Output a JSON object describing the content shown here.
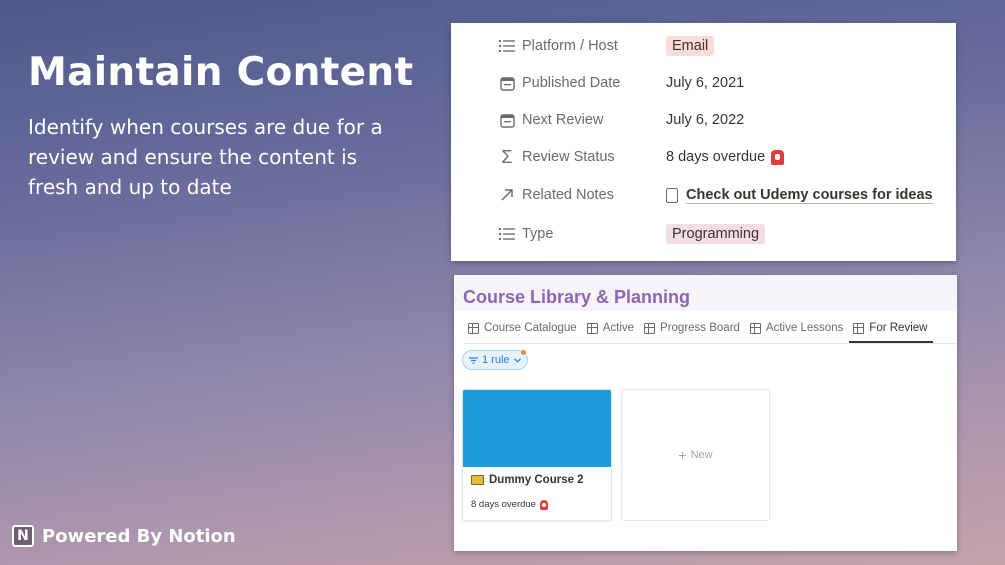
{
  "hero": {
    "title": "Maintain Content",
    "subtitle": "Identify when courses are due for a review and ensure the content is fresh and up to date"
  },
  "brand": {
    "logo_letter": "N",
    "text": "Powered By Notion"
  },
  "properties": [
    {
      "icon": "list-icon",
      "label": "Platform / Host",
      "value": "Email",
      "kind": "tag",
      "tag_color": "#fbdcd7"
    },
    {
      "icon": "calendar-icon",
      "label": "Published Date",
      "value": "July 6, 2021",
      "kind": "text"
    },
    {
      "icon": "calendar-icon",
      "label": "Next Review",
      "value": "July 6, 2022",
      "kind": "text"
    },
    {
      "icon": "sigma-icon",
      "label": "Review Status",
      "value": "8 days overdue",
      "kind": "text",
      "badge": "alarm-icon"
    },
    {
      "icon": "arrow-up-right-icon",
      "label": "Related Notes",
      "value": "Check out Udemy courses for ideas",
      "kind": "link"
    },
    {
      "icon": "list-icon",
      "label": "Type",
      "value": "Programming",
      "kind": "tag",
      "tag_color": "#f4dde5"
    }
  ],
  "database": {
    "title": "Course Library & Planning",
    "tabs": [
      {
        "label": "Course Catalogue",
        "icon": "table-icon",
        "active": false
      },
      {
        "label": "Active",
        "icon": "table-icon",
        "active": false
      },
      {
        "label": "Progress Board",
        "icon": "board-icon",
        "active": false
      },
      {
        "label": "Active Lessons",
        "icon": "table-icon",
        "active": false
      },
      {
        "label": "For Review",
        "icon": "gallery-icon",
        "active": true
      }
    ],
    "filter": {
      "label": "1 rule",
      "icon": "filter-icon"
    },
    "cards": [
      {
        "title": "Dummy Course 2",
        "status": "8 days overdue",
        "cover_color": "#1a9ad6"
      }
    ],
    "new_label": "New"
  },
  "colors": {
    "title_purple": "#9065b0",
    "alarm_red": "#e03e3e"
  }
}
